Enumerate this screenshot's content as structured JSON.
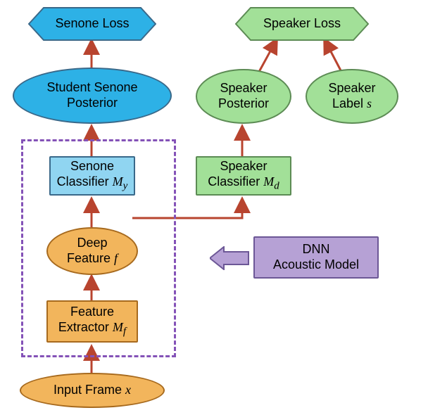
{
  "senone_loss": "Senone Loss",
  "speaker_loss": "Speaker Loss",
  "student_senone_posterior_l1": "Student Senone",
  "student_senone_posterior_l2": "Posterior",
  "speaker_posterior_l1": "Speaker",
  "speaker_posterior_l2": "Posterior",
  "speaker_label_l1": "Speaker",
  "speaker_label_l2": "Label ",
  "speaker_label_var": "s",
  "senone_classifier_l1": "Senone",
  "senone_classifier_l2a": "Classifier ",
  "senone_classifier_var": "M",
  "senone_classifier_sub": "y",
  "speaker_classifier_l1": "Speaker",
  "speaker_classifier_l2a": "Classifier ",
  "speaker_classifier_var": "M",
  "speaker_classifier_sub": "d",
  "deep_feature_l1": "Deep",
  "deep_feature_l2a": "Feature ",
  "deep_feature_var": "f",
  "feature_extractor_l1": "Feature",
  "feature_extractor_l2a": "Extractor ",
  "feature_extractor_var": "M",
  "feature_extractor_sub": "f",
  "input_frame_a": "Input Frame ",
  "input_frame_var": "x",
  "dnn_l1": "DNN",
  "dnn_l2": "Acoustic Model",
  "colors": {
    "blue_fill": "#2DB1E6",
    "blue_light": "#90D5F1",
    "green": "#A2E098",
    "orange": "#F2B55C",
    "purple": "#B6A1D5",
    "arrow": "#B8442F"
  }
}
